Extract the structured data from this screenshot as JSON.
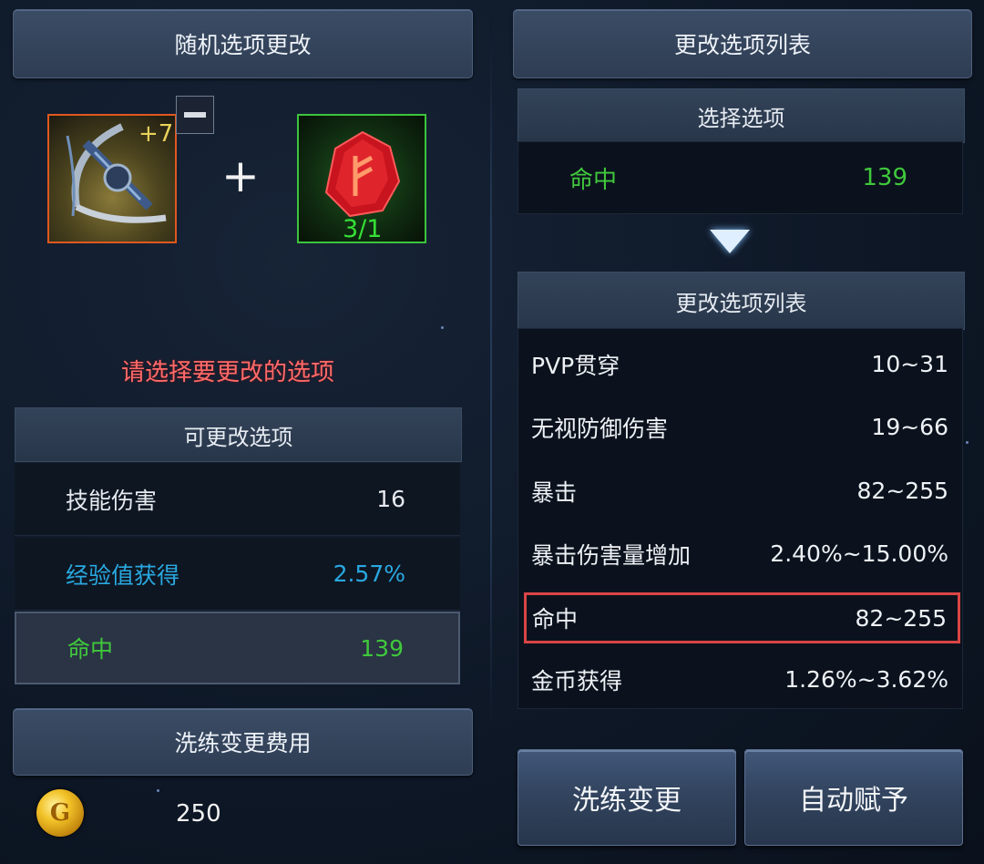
{
  "left": {
    "header": "随机选项更改",
    "weapon": {
      "enhance": "+7",
      "icon": "crossbow-weapon-icon"
    },
    "plus": "+",
    "rune": {
      "count": "3/1",
      "icon": "red-rune-stone-icon"
    },
    "warning": "请选择要更改的选项",
    "changeable_header": "可更改选项",
    "options": [
      {
        "label": "技能伤害",
        "value": "16",
        "color": "#e6e9ee"
      },
      {
        "label": "经验值获得",
        "value": "2.57%",
        "color": "#29a8e0"
      },
      {
        "label": "命中",
        "value": "139",
        "color": "#40c83c",
        "selected": true
      }
    ],
    "cost_header": "洗练变更费用",
    "cost_value": "250",
    "coin_icon": "gold-coin-icon"
  },
  "right": {
    "header": "更改选项列表",
    "select_header": "选择选项",
    "selected": {
      "label": "命中",
      "value": "139"
    },
    "list_header": "更改选项列表",
    "list": [
      {
        "label": "PVP贯穿",
        "range": "10~31"
      },
      {
        "label": "无视防御伤害",
        "range": "19~66"
      },
      {
        "label": "暴击",
        "range": "82~255"
      },
      {
        "label": "暴击伤害量增加",
        "range": "2.40%~15.00%"
      },
      {
        "label": "命中",
        "range": "82~255",
        "highlighted": true
      },
      {
        "label": "金币获得",
        "range": "1.26%~3.62%"
      }
    ],
    "buttons": {
      "refine": "洗练变更",
      "auto": "自动赋予"
    }
  },
  "colors": {
    "highlight": "#d94545",
    "green": "#40c83c",
    "cyan": "#29a8e0",
    "warning": "#ff6a6a"
  }
}
